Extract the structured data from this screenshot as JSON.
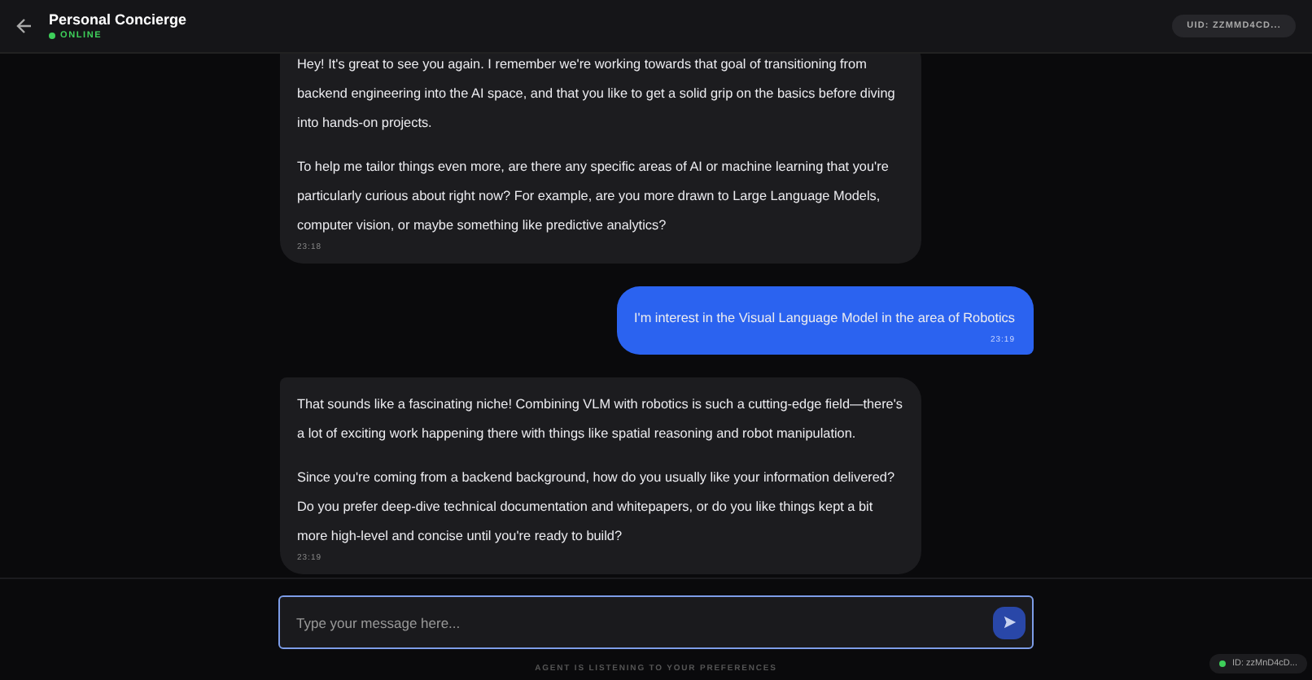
{
  "header": {
    "title": "Personal Concierge",
    "status": "ONLINE",
    "online": true,
    "uid": "UID: ZZMMD4CD..."
  },
  "messages": [
    {
      "kind": "agent",
      "paragraphs": [
        "Hey! It's great to see you again. I remember we're working towards that goal of transitioning from backend engineering into the AI space, and that you like to get a solid grip on the basics before diving into hands-on projects.",
        "To help me tailor things even more, are there any specific areas of AI or machine learning that you're particularly curious about right now? For example, are you more drawn to Large Language Models, computer vision, or maybe something like predictive analytics?"
      ],
      "time": "23:18"
    },
    {
      "kind": "user",
      "paragraphs": [
        "I'm interest in the Visual Language Model in the area of Robotics"
      ],
      "time": "23:19"
    },
    {
      "kind": "agent",
      "paragraphs": [
        "That sounds like a fascinating niche! Combining VLM with robotics is such a cutting-edge field—there's a lot of exciting work happening there with things like spatial reasoning and robot manipulation.",
        "Since you're coming from a backend background, how do you usually like your information delivered? Do you prefer deep-dive technical documentation and whitepapers, or do you like things kept a bit more high-level and concise until you're ready to build?"
      ],
      "time": "23:19"
    }
  ],
  "composer": {
    "placeholder": "Type your message here..."
  },
  "footer_note": "AGENT IS LISTENING TO YOUR PREFERENCES",
  "id_badge": {
    "text": "ID: zzMnD4cD...",
    "online": true
  }
}
